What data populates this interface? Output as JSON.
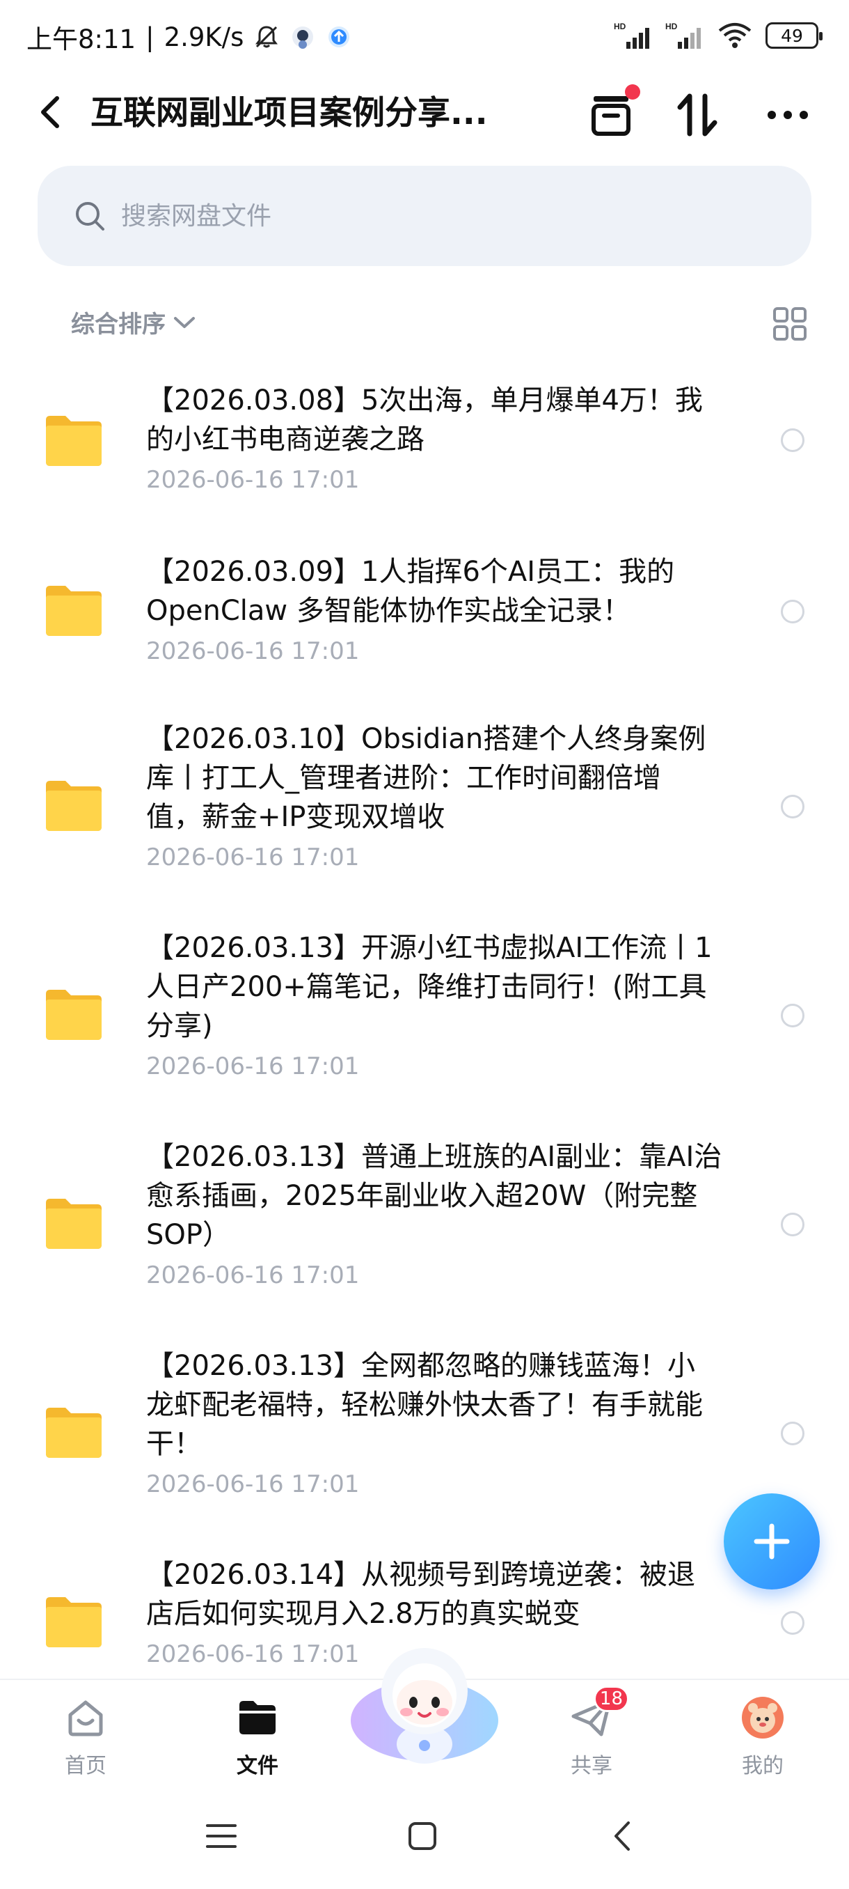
{
  "status_bar": {
    "time": "上午8:11",
    "separator": "|",
    "net_speed": "2.9K/s",
    "battery": "49",
    "network_tags": [
      "HD",
      "HD"
    ]
  },
  "app_bar": {
    "title": "互联网副业项目案例分享...",
    "icons": [
      "back-icon",
      "inbox-icon",
      "sort-transfer-icon",
      "more-icon"
    ]
  },
  "search": {
    "placeholder": "搜索网盘文件"
  },
  "sort": {
    "label": "综合排序"
  },
  "files": [
    {
      "name_line1": "【2026.03.08】5次出海，单月爆单4万！我",
      "name_line2": "的小红书电商逆袭之路",
      "name_line3": "",
      "date": "2026-06-16  17:01"
    },
    {
      "name_line1": "【2026.03.09】1人指挥6个AI员工：我的",
      "name_line2": "OpenClaw 多智能体协作实战全记录！",
      "name_line3": "",
      "date": "2026-06-16  17:01"
    },
    {
      "name_line1": "【2026.03.10】Obsidian搭建个人终身案例",
      "name_line2": "库丨打工人_管理者进阶：工作时间翻倍增",
      "name_line3": "值，薪金+IP变现双增收",
      "date": "2026-06-16  17:01"
    },
    {
      "name_line1": "【2026.03.13】开源小红书虚拟AI工作流丨1",
      "name_line2": "人日产200+篇笔记，降维打击同行！(附工具",
      "name_line3": "分享)",
      "date": "2026-06-16  17:01"
    },
    {
      "name_line1": "【2026.03.13】普通上班族的AI副业：靠AI治",
      "name_line2": "愈系插画，2025年副业收入超20W（附完整",
      "name_line3": "SOP）",
      "date": "2026-06-16  17:01"
    },
    {
      "name_line1": "【2026.03.13】全网都忽略的赚钱蓝海！小",
      "name_line2": "龙虾配老福特，轻松赚外快太香了！有手就能",
      "name_line3": "干！",
      "date": "2026-06-16  17:01"
    },
    {
      "name_line1": "【2026.03.14】从视频号到跨境逆袭：被退",
      "name_line2": "店后如何实现月入2.8万的真实蜕变",
      "name_line3": "",
      "date": "2026-06-16  17:01"
    }
  ],
  "fab": {
    "icon": "plus-icon"
  },
  "bottom_nav": {
    "home": "首页",
    "files": "文件",
    "share": "共享",
    "share_badge": "18",
    "mine": "我的"
  },
  "colors": {
    "accent": "#2e8bff",
    "folder": "#ffcf3d",
    "badge": "#f2364e",
    "search_bg": "#eef2f8"
  }
}
